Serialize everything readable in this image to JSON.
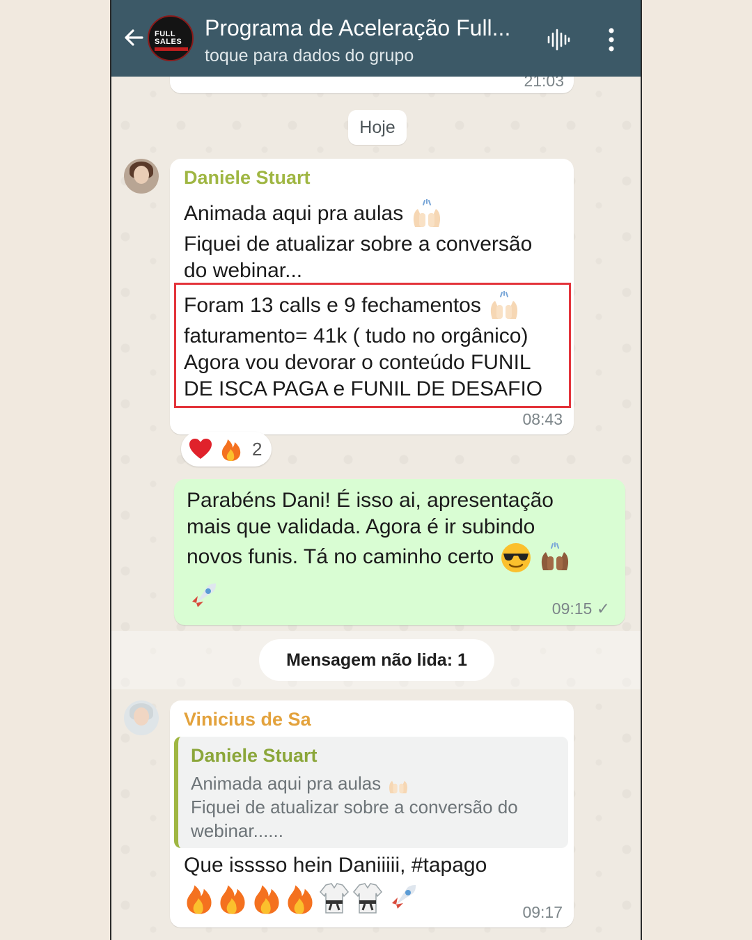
{
  "header": {
    "title": "Programa de Aceleração Full...",
    "subtitle": "toque para dados do grupo",
    "avatar_text": "FULL SALES SYSTEM",
    "icons": [
      "back-arrow-icon",
      "audio-wave-icon",
      "more-vert-icon"
    ]
  },
  "previous_message": {
    "time": "21:03"
  },
  "date_chip": "Hoje",
  "message1": {
    "sender": "Daniele Stuart",
    "sender_color": "#9fb642",
    "line1": "Animada aqui pra aulas",
    "line2": "Fiquei de atualizar sobre a conversão",
    "line3": "do webinar...",
    "line4": " Foram 13 calls e 9 fechamentos",
    "line5": "faturamento= 41k ( tudo no orgânico)",
    "line6": "Agora vou devorar o conteúdo FUNIL",
    "line7": "DE ISCA PAGA e FUNIL DE DESAFIO",
    "time": "08:43",
    "reactions": {
      "icons": [
        "heart-icon",
        "fire-icon"
      ],
      "count": "2"
    }
  },
  "message2": {
    "line1": "Parabéns Dani! É isso ai, apresentação",
    "line2": "mais que validada. Agora é ir subindo",
    "line3": "novos funis. Tá no caminho certo",
    "time": "09:15 ✓"
  },
  "unread_label": "Mensagem não lida: 1",
  "message3": {
    "sender": "Vinicius de Sa",
    "sender_color": "#e3a23c",
    "quote": {
      "name": "Daniele Stuart",
      "line1": "Animada aqui pra aulas",
      "line2": "Fiquei de atualizar sobre a conversão do",
      "line3": "webinar......"
    },
    "text": "Que isssso hein Daniiiii, #tapago",
    "time": "09:17"
  },
  "colors": {
    "header": "#3c5967",
    "chat_bg": "#efeae2",
    "outgoing_bubble": "#d9fdd3",
    "highlight": "#e3343b"
  }
}
